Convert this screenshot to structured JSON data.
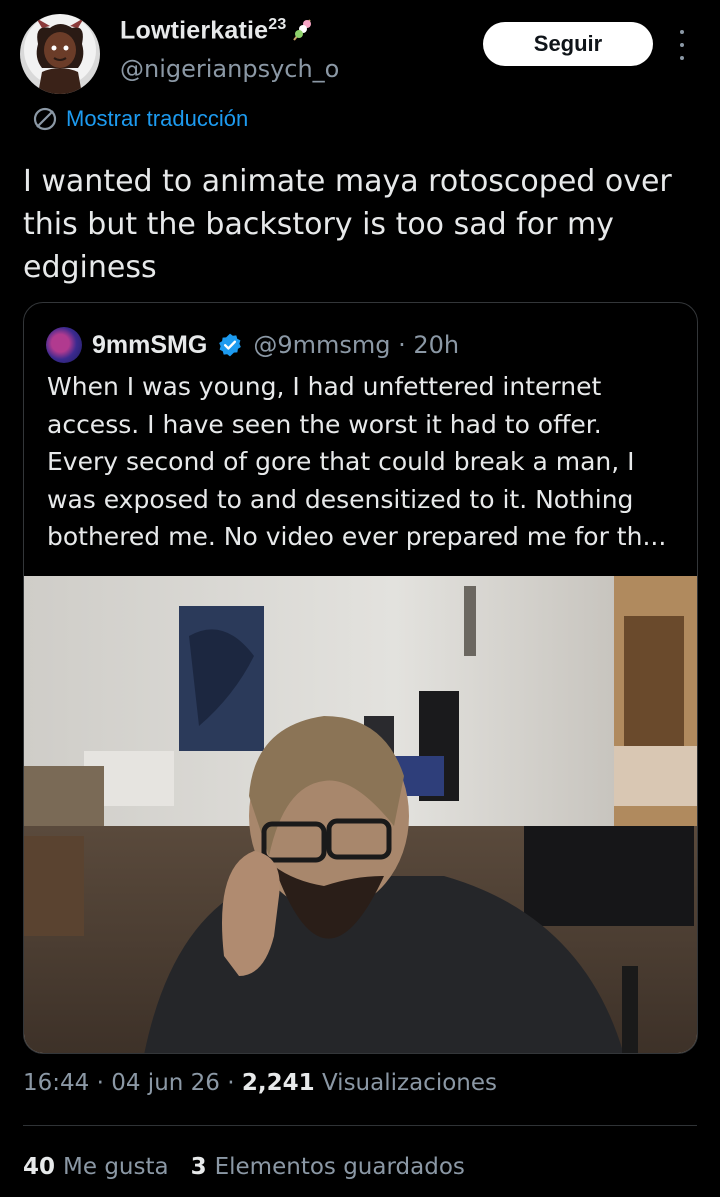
{
  "author": {
    "display_name": "Lowtierkatie",
    "badge": "23",
    "handle": "@nigerianpsych_o"
  },
  "follow_button": "Seguir",
  "translate_link": "Mostrar traducción",
  "tweet_text": "I wanted to animate maya rotoscoped over this but the backstory is too sad for my edginess",
  "quoted": {
    "name": "9mmSMG",
    "handle": "@9mmsmg",
    "separator": "·",
    "time": "20h",
    "text": "When I was young, I had unfettered internet access. I have seen the worst it had to offer. Every second of gore that could break a man, I was exposed to and desensitized to it. Nothing bothered me. No video ever prepared me for th..."
  },
  "meta": {
    "time": "16:44",
    "sep1": "·",
    "date": "04 jun 26",
    "sep2": "·",
    "views_count": "2,241",
    "views_label": "Visualizaciones"
  },
  "stats": {
    "likes_count": "40",
    "likes_label": "Me gusta",
    "saves_count": "3",
    "saves_label": "Elementos guardados"
  },
  "colors": {
    "background": "#000000",
    "link": "#1d9bf0",
    "secondary_text": "#8b98a5",
    "verified": "#1d9bf0",
    "border": "#333639"
  },
  "icons": {
    "translate": "globe-icon",
    "verified": "verified-badge-icon",
    "more": "more-options-icon",
    "emoji": "dango-icon"
  }
}
